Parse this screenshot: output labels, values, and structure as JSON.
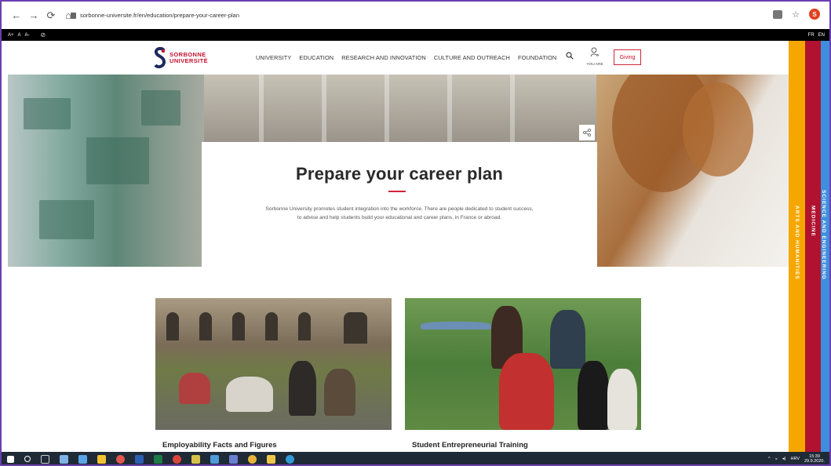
{
  "browser": {
    "url": "sorbonne-universite.fr/en/education/prepare-your-career-plan",
    "profile_initial": "S"
  },
  "a11y_bar": {
    "sizes": [
      "A+",
      "A",
      "A-"
    ],
    "languages": [
      "FR",
      "EN"
    ]
  },
  "header": {
    "logo_line1": "SORBONNE",
    "logo_line2": "UNIVERSITÉ",
    "nav": [
      "UNIVERSITY",
      "EDUCATION",
      "RESEARCH AND INNOVATION",
      "CULTURE AND OUTREACH",
      "FOUNDATION"
    ],
    "you_are": "YOU ARE",
    "giving": "Giving"
  },
  "side_tabs": {
    "arts": "ARTS AND HUMANITIES",
    "medicine": "MEDICINE",
    "science": "SCIENCE AND ENGINEERING"
  },
  "hero": {
    "title": "Prepare your career plan",
    "text": "Sorbonne University promotes student integration into the workforce. There are people dedicated to student success, to advise and help students build your educational and career plans, in France or abroad."
  },
  "tiles": [
    {
      "title": "Employability Facts and Figures"
    },
    {
      "title": "Student Entrepreneurial Training"
    }
  ],
  "taskbar": {
    "lang": "HRV",
    "time": "15:39",
    "date": "29.9.2020."
  },
  "colors": {
    "accent": "#c8102e",
    "arts": "#f5a700",
    "medicine": "#b0122f",
    "science": "#3e8ede"
  }
}
